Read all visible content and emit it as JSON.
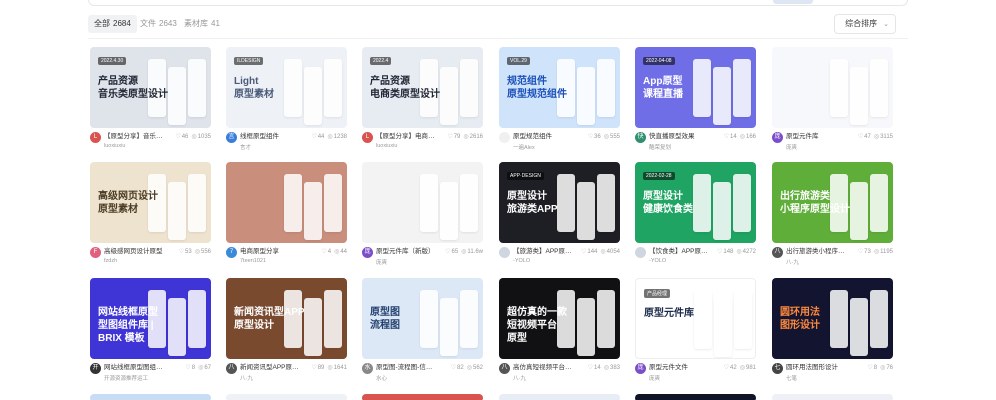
{
  "filters": [
    {
      "label": "全部",
      "count": "2684",
      "active": true
    },
    {
      "label": "文件",
      "count": "2643",
      "active": false
    },
    {
      "label": "素材库",
      "count": "41",
      "active": false
    }
  ],
  "sort": {
    "label": "综合排序"
  },
  "cards": [
    {
      "title": "【原型分享】音乐类原型设计",
      "author": "luoxiuxiu",
      "likes": "46",
      "views": "1035",
      "bg": "#dfe3ea",
      "thumb_title": "产品资源\n音乐类原型设计",
      "thumb_title_color": "#1f2533",
      "tag": "2022.4.30",
      "avatar_color": "#d9534f",
      "avatar_text": "L"
    },
    {
      "title": "线框原型组件",
      "author": "言才",
      "likes": "44",
      "views": "1238",
      "bg": "#eef2f7",
      "thumb_title": "Light\n原型素材",
      "thumb_title_color": "#4a5a7a",
      "tag": "ILDESIGN",
      "avatar_color": "#3b7dd8",
      "avatar_text": "言"
    },
    {
      "title": "【原型分享】电商原型设计",
      "author": "luoxiuxiu",
      "likes": "79",
      "views": "2616",
      "bg": "#e6ecf2",
      "thumb_title": "产品资源\n电商类原型设计",
      "thumb_title_color": "#1f2533",
      "tag": "2022.4",
      "avatar_color": "#d9534f",
      "avatar_text": "L"
    },
    {
      "title": "原型规范组件",
      "author": "一遍Alex",
      "likes": "36",
      "views": "555",
      "bg": "#cfe3fb",
      "thumb_title": "规范组件\n原型规范组件",
      "thumb_title_color": "#1b4fb8",
      "tag": "VOL.29",
      "avatar_color": "#f0f0f0",
      "avatar_text": ""
    },
    {
      "title": "快直播原型效果",
      "author": "酷荣复划",
      "likes": "14",
      "views": "166",
      "bg": "#6f6ee6",
      "thumb_title": "App原型\n课程直播",
      "thumb_title_color": "#ffffff",
      "tag": "2022-04-08",
      "avatar_color": "#2f8f6f",
      "avatar_text": "快"
    },
    {
      "title": "原型元件库",
      "author": "庞爽",
      "likes": "47",
      "views": "3115",
      "bg": "#f7f8fb",
      "thumb_title": "",
      "thumb_title_color": "#333333",
      "tag": "",
      "avatar_color": "#7b4ec9",
      "avatar_text": "庞"
    },
    {
      "title": "高级感网页设计原型",
      "author": "fzdzh",
      "likes": "53",
      "views": "556",
      "bg": "#eee3cf",
      "thumb_title": "高级网页设计\n原型素材",
      "thumb_title_color": "#4a3b22",
      "tag": "",
      "avatar_color": "#e0607e",
      "avatar_text": "F"
    },
    {
      "title": "电商原型分享",
      "author": "7teen1021",
      "likes": "4",
      "views": "44",
      "bg": "#c98e7c",
      "thumb_title": "",
      "thumb_title_color": "#ffffff",
      "tag": "",
      "avatar_color": "#3b8ad8",
      "avatar_text": "7"
    },
    {
      "title": "原型元件库（新版）",
      "author": "庞爽",
      "likes": "65",
      "views": "11.6w",
      "bg": "#f3f3f3",
      "thumb_title": "",
      "thumb_title_color": "#333333",
      "tag": "",
      "avatar_color": "#7b4ec9",
      "avatar_text": "庞"
    },
    {
      "title": "【旅游类】APP原型设计",
      "author": "-YOLO",
      "likes": "144",
      "views": "4054",
      "bg": "#1e1f24",
      "thumb_title": "原型设计\n旅游类APP",
      "thumb_title_color": "#ffffff",
      "tag": "APP·DESIGN",
      "avatar_color": "#d0d6e0",
      "avatar_text": ""
    },
    {
      "title": "【饮食类】APP原型设计",
      "author": "-YOLO",
      "likes": "148",
      "views": "4272",
      "bg": "#1fa463",
      "thumb_title": "原型设计\n健康饮食类",
      "thumb_title_color": "#ffffff",
      "tag": "2022-02-28",
      "avatar_color": "#d0d6e0",
      "avatar_text": ""
    },
    {
      "title": "出行旅游类小程序原型设计",
      "author": "八·九",
      "likes": "73",
      "views": "1195",
      "bg": "#5fae3a",
      "thumb_title": "出行旅游类\n小程序原型设计",
      "thumb_title_color": "#ffffff",
      "tag": "",
      "avatar_color": "#555555",
      "avatar_text": "八"
    },
    {
      "title": "网站线框原型图组件库 | BRIX",
      "author": "开源资源推荐运工",
      "likes": "8",
      "views": "67",
      "bg": "#3f34d6",
      "thumb_title": "网站线框原型\n型图组件库 |\nBRIX 模板",
      "thumb_title_color": "#ffffff",
      "tag": "",
      "avatar_color": "#333333",
      "avatar_text": "开"
    },
    {
      "title": "新闻资讯型APP原型设计",
      "author": "八·九",
      "likes": "89",
      "views": "1641",
      "bg": "#7a4a2e",
      "thumb_title": "新闻资讯型APP\n原型设计",
      "thumb_title_color": "#ffffff",
      "tag": "",
      "avatar_color": "#555555",
      "avatar_text": "八"
    },
    {
      "title": "原型图-流程图-信息框架",
      "author": "水心",
      "likes": "82",
      "views": "562",
      "bg": "#dde8f7",
      "thumb_title": "原型图\n流程图",
      "thumb_title_color": "#23406e",
      "tag": "",
      "avatar_color": "#888888",
      "avatar_text": "水"
    },
    {
      "title": "高仿真短视频平台原型",
      "author": "八·九",
      "likes": "14",
      "views": "383",
      "bg": "#111114",
      "thumb_title": "超仿真的一款\n短视频平台\n原型",
      "thumb_title_color": "#ffffff",
      "tag": "",
      "avatar_color": "#555555",
      "avatar_text": "八"
    },
    {
      "title": "原型元件文件",
      "author": "庞爽",
      "likes": "42",
      "views": "981",
      "bg": "#ffffff",
      "thumb_title": "原型元件库",
      "thumb_title_color": "#1a2a4a",
      "tag": "产品经理",
      "avatar_color": "#7b4ec9",
      "avatar_text": "庞"
    },
    {
      "title": "圆环用法图形设计",
      "author": "七笔",
      "likes": "8",
      "views": "76",
      "bg": "#131530",
      "thumb_title": "圆环用法\n图形设计",
      "thumb_title_color": "#ff8a3d",
      "tag": "",
      "avatar_color": "#444444",
      "avatar_text": "七"
    }
  ],
  "next_row_colors": [
    "#c9dcf6",
    "#eef1f6",
    "#d9534f",
    "#e8edf5",
    "#111428",
    "#eef0f5"
  ]
}
